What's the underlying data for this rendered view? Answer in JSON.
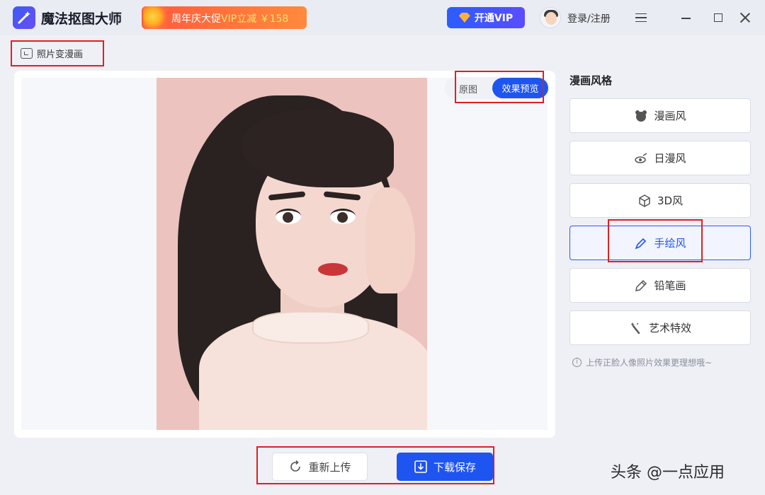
{
  "app": {
    "name": "魔法抠图大师"
  },
  "promo": {
    "text_prefix": "周年庆大促",
    "text_vip": "VIP立减 ￥158"
  },
  "header": {
    "vip_label": "开通VIP",
    "login_label": "登录/注册"
  },
  "breadcrumb": {
    "label": "照片变漫画"
  },
  "preview_toggle": {
    "original": "原图",
    "preview": "效果预览",
    "active": "preview"
  },
  "styles": {
    "title": "漫画风格",
    "items": [
      {
        "label": "漫画风",
        "icon": "bear-icon"
      },
      {
        "label": "日漫风",
        "icon": "anime-icon"
      },
      {
        "label": "3D风",
        "icon": "cube-icon"
      },
      {
        "label": "手绘风",
        "icon": "brush-icon",
        "active": true
      },
      {
        "label": "铅笔画",
        "icon": "pencil-icon"
      },
      {
        "label": "艺术特效",
        "icon": "magic-wand-icon"
      }
    ],
    "tip": "上传正脸人像照片效果更理想哦~"
  },
  "actions": {
    "reupload": "重新上传",
    "download": "下载保存"
  },
  "watermark": "头条 @一点应用",
  "colors": {
    "accent": "#1e54f0",
    "highlight_box": "#e02020"
  }
}
